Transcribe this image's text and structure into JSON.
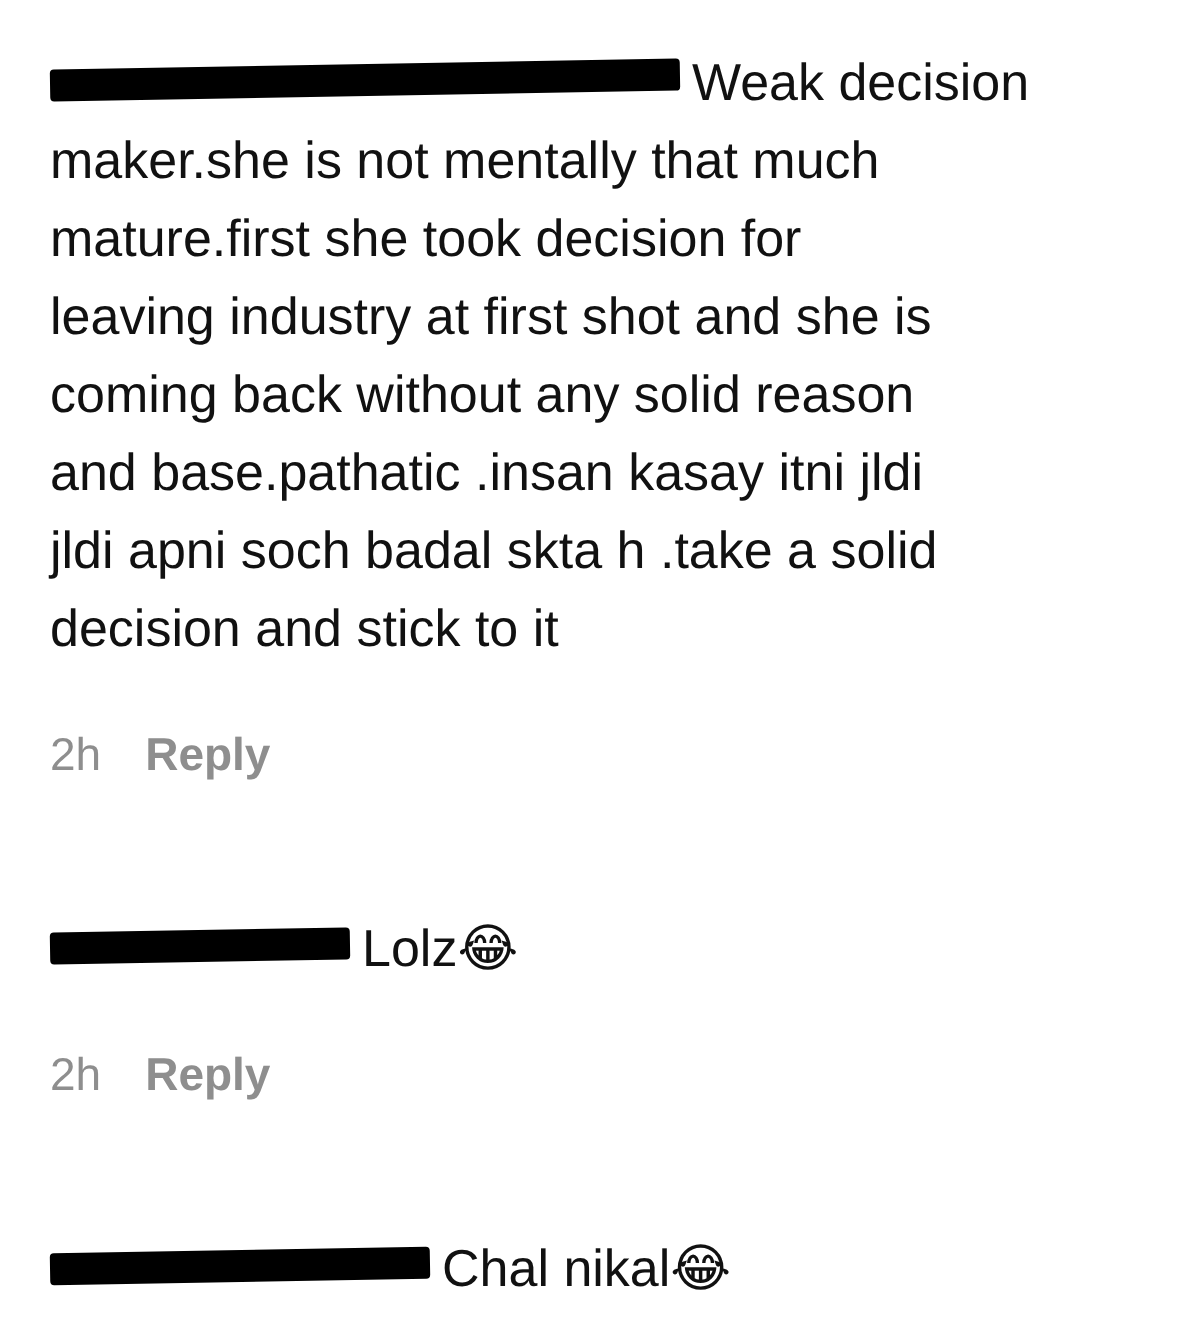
{
  "comments": [
    {
      "username_redacted": true,
      "text": "Weak decision\nmaker.she is not mentally that much\nmature.first she took decision for\nleaving industry at first shot and she is\ncoming back without any solid reason\nand base.pathatic .insan kasay itni jldi\njldi apni soch badal skta h .take a solid\ndecision and stick to it",
      "time": "2h",
      "reply": "Reply"
    },
    {
      "username_redacted": true,
      "text": "Lolz😂",
      "time": "2h",
      "reply": "Reply"
    },
    {
      "username_redacted": true,
      "text": "Chal nikal😂"
    }
  ]
}
